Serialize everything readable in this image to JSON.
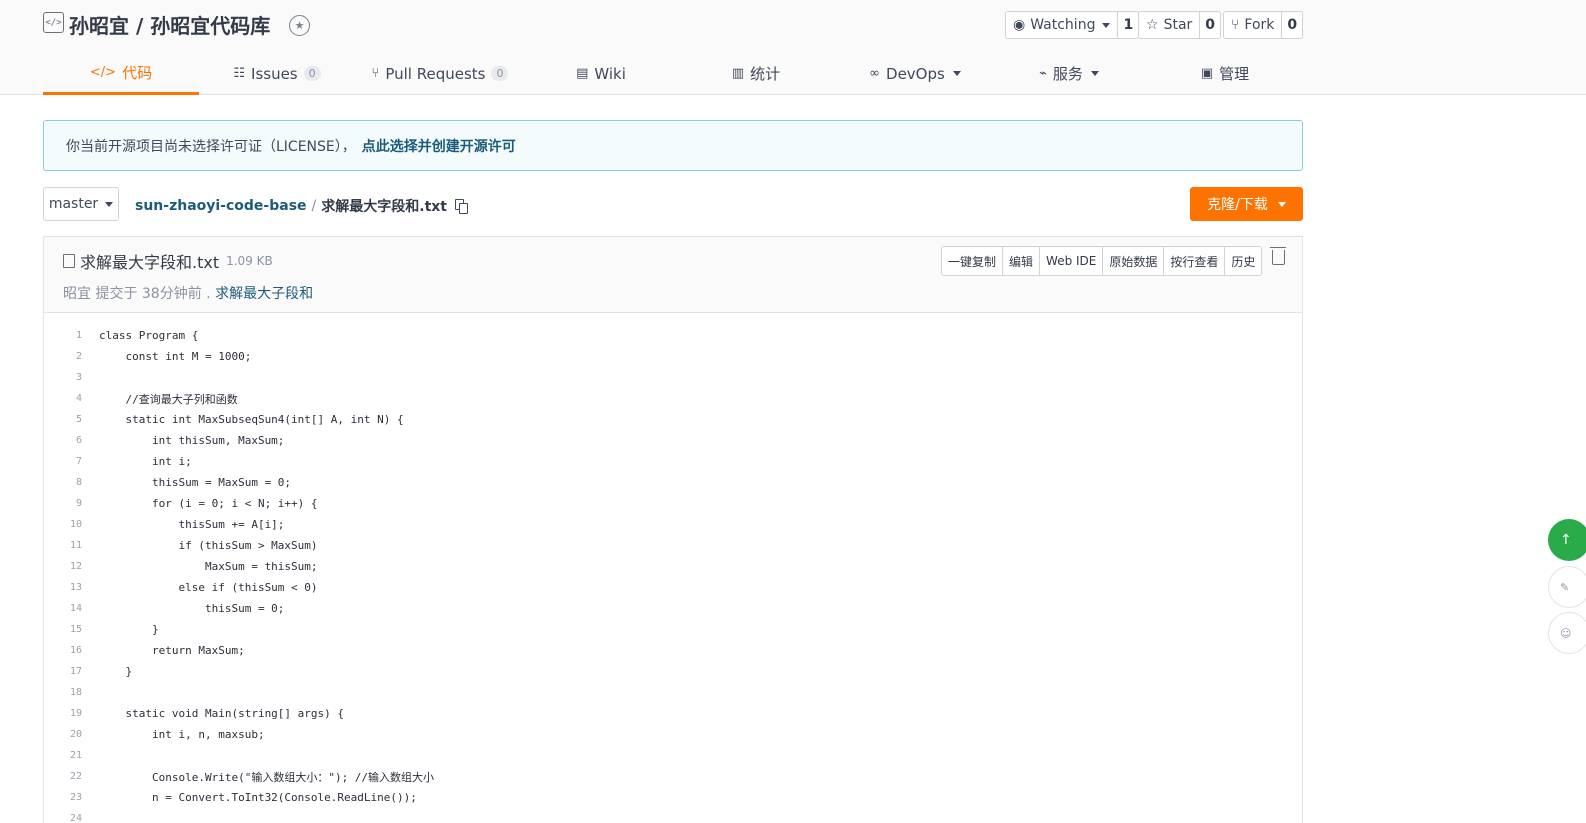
{
  "header": {
    "repo_title": "孙昭宜 / 孙昭宜代码库",
    "watching": {
      "label": "Watching",
      "count": "1"
    },
    "star": {
      "label": "Star",
      "count": "0"
    },
    "fork": {
      "label": "Fork",
      "count": "0"
    }
  },
  "tabs": [
    {
      "label": "代码",
      "icon": "code-icon",
      "active": true
    },
    {
      "label": "Issues",
      "count": "0",
      "icon": "issues-icon"
    },
    {
      "label": "Pull Requests",
      "count": "0",
      "icon": "pull-request-icon"
    },
    {
      "label": "Wiki",
      "icon": "book-icon"
    },
    {
      "label": "统计",
      "icon": "chart-icon"
    },
    {
      "label": "DevOps",
      "icon": "infinity-icon",
      "dropdown": true
    },
    {
      "label": "服务",
      "icon": "pulse-icon",
      "dropdown": true
    },
    {
      "label": "管理",
      "icon": "settings-doc-icon"
    }
  ],
  "license_notice": {
    "text": "你当前开源项目尚未选择许可证（LICENSE），",
    "link": "点此选择并创建开源许可"
  },
  "toolbar": {
    "branch": "master",
    "breadcrumb_repo": "sun-zhaoyi-code-base",
    "breadcrumb_sep": "/",
    "breadcrumb_file": "求解最大字段和.txt",
    "clone_label": "克隆/下载"
  },
  "file": {
    "name": "求解最大字段和.txt",
    "size": "1.09 KB",
    "commit_text": "昭宜 提交于 38分钟前 .",
    "commit_link": "求解最大子段和",
    "actions": [
      "一键复制",
      "编辑",
      "Web IDE",
      "原始数据",
      "按行查看",
      "历史"
    ]
  },
  "code_lines": [
    "class Program {",
    "    const int M = 1000;",
    "",
    "    //查询最大子列和函数",
    "    static int MaxSubseqSun4(int[] A, int N) {",
    "        int thisSum, MaxSum;",
    "        int i;",
    "        thisSum = MaxSum = 0;",
    "        for (i = 0; i < N; i++) {",
    "            thisSum += A[i];",
    "            if (thisSum > MaxSum)",
    "                MaxSum = thisSum;",
    "            else if (thisSum < 0)",
    "                thisSum = 0;",
    "        }",
    "        return MaxSum;",
    "    }",
    "",
    "    static void Main(string[] args) {",
    "        int i, n, maxsub;",
    "",
    "        Console.Write(\"输入数组大小：\"); //输入数组大小",
    "        n = Convert.ToInt32(Console.ReadLine());",
    ""
  ],
  "colors": {
    "accent": "#fe7300",
    "link": "#1c5c79",
    "notice_bg": "#f3fbfd",
    "notice_border": "#87cedb",
    "fab": "#2aab4a"
  }
}
